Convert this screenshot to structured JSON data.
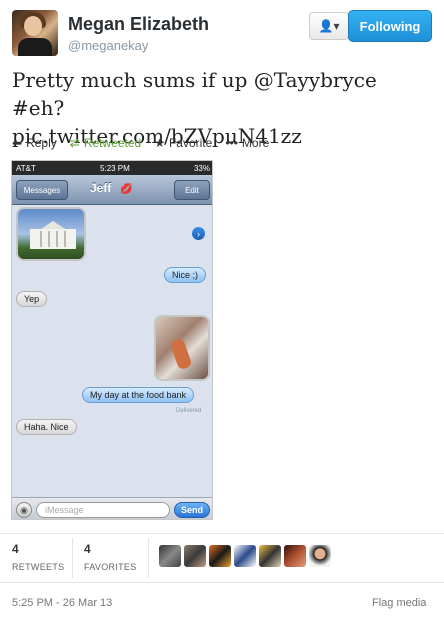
{
  "user": {
    "name": "Megan Elizabeth",
    "handle": "@meganekay"
  },
  "buttons": {
    "user_menu_icon": "user-icon",
    "follow": "Following"
  },
  "tweet": {
    "line1": "Pretty much sums if up @Tayybryce  #eh?",
    "line2": "pic.twitter.com/bZVpuN41zz"
  },
  "actions": {
    "reply": "Reply",
    "retweeted": "Retweeted",
    "favorite": "Favorite",
    "more": "More"
  },
  "media": {
    "status": {
      "carrier": "AT&T",
      "time": "5:23 PM",
      "battery": "33%"
    },
    "nav": {
      "back": "Messages",
      "title": "Jeff",
      "edit": "Edit"
    },
    "messages": [
      {
        "text": "Nice ;)"
      },
      {
        "text": "Yep"
      },
      {
        "text": "My day at the food bank"
      },
      {
        "text": "Haha. Nice"
      }
    ],
    "delivered": "Delivered",
    "input_placeholder": "iMessage",
    "send": "Send"
  },
  "stats": {
    "retweets": "4",
    "retweets_label": "RETWEETS",
    "favorites": "4",
    "favorites_label": "FAVORITES"
  },
  "footer": {
    "timestamp": "5:25 PM - 26 Mar 13",
    "flag": "Flag media"
  },
  "colors": {
    "follow_blue": "#1d8fd8",
    "retweet_green": "#5c9e31",
    "imessage_blue": "#8ec2f4"
  }
}
